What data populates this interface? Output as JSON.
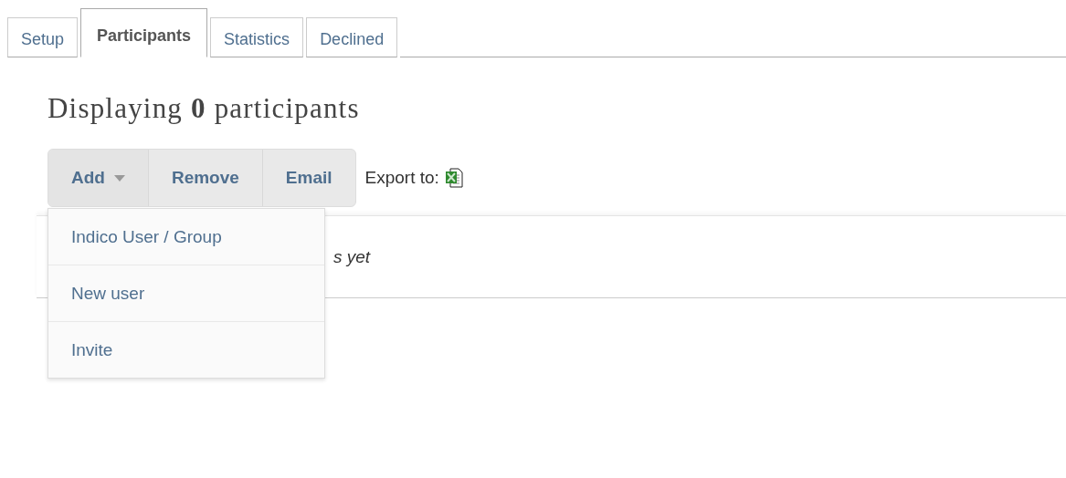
{
  "tabs": [
    {
      "label": "Setup",
      "selected": false
    },
    {
      "label": "Participants",
      "selected": true
    },
    {
      "label": "Statistics",
      "selected": false
    },
    {
      "label": "Declined",
      "selected": false
    }
  ],
  "heading": "Displaying **0** participants",
  "toolbar": {
    "buttons": [
      {
        "label": "Add",
        "kind": "dropdown",
        "expanded": true
      },
      {
        "label": "Remove",
        "kind": "plain"
      },
      {
        "label": "Email",
        "kind": "plain"
      }
    ],
    "export_label": "Export to:"
  },
  "add_menu": [
    "Indico User / Group",
    "New user",
    "Invite"
  ],
  "empty_message": "s yet"
}
